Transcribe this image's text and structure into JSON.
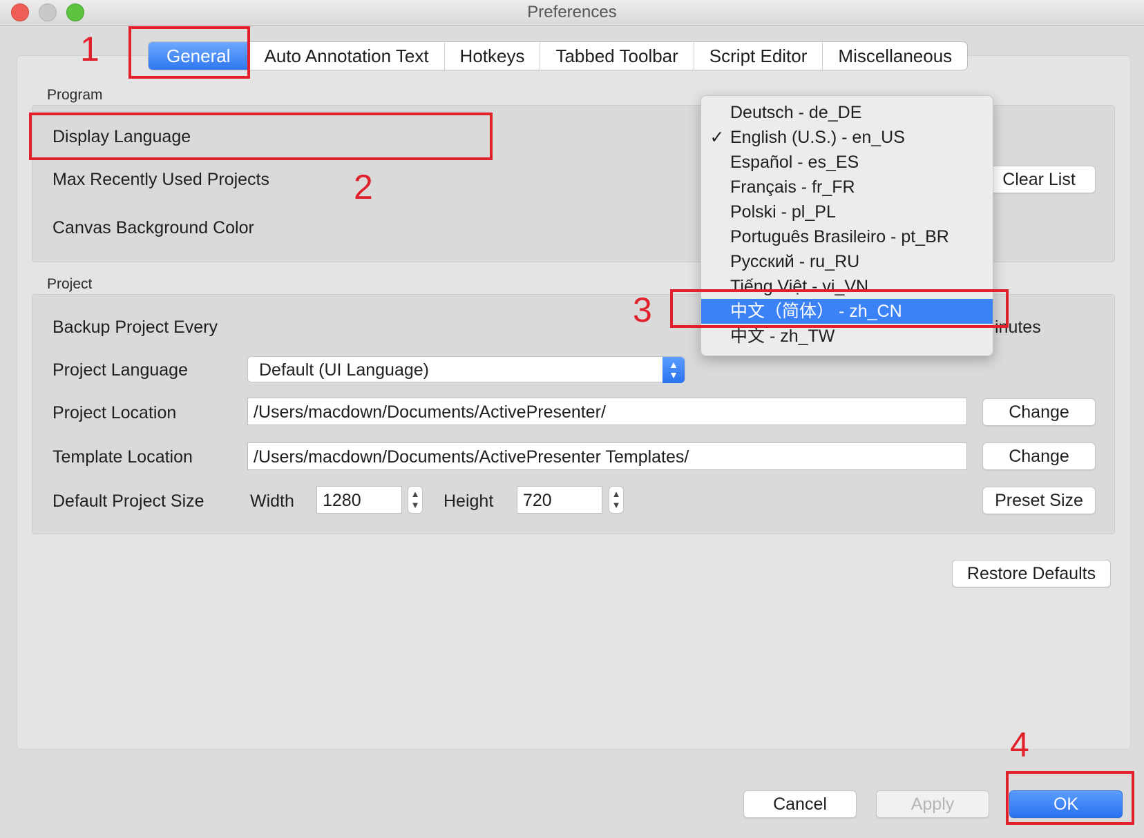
{
  "window": {
    "title": "Preferences"
  },
  "tabs": [
    {
      "label": "General",
      "active": true
    },
    {
      "label": "Auto Annotation Text",
      "active": false
    },
    {
      "label": "Hotkeys",
      "active": false
    },
    {
      "label": "Tabbed Toolbar",
      "active": false
    },
    {
      "label": "Script Editor",
      "active": false
    },
    {
      "label": "Miscellaneous",
      "active": false
    }
  ],
  "program": {
    "section_label": "Program",
    "display_language_label": "Display Language",
    "max_recent_label": "Max Recently Used Projects",
    "clear_list_label": "Clear List",
    "canvas_bg_label": "Canvas Background Color"
  },
  "project": {
    "section_label": "Project",
    "backup_label": "Backup Project Every",
    "backup_units_partial": "inutes",
    "project_language_label": "Project Language",
    "project_language_value": "Default (UI Language)",
    "project_location_label": "Project Location",
    "project_location_value": "/Users/macdown/Documents/ActivePresenter/",
    "template_location_label": "Template Location",
    "template_location_value": "/Users/macdown/Documents/ActivePresenter Templates/",
    "change_label": "Change",
    "default_size_label": "Default Project Size",
    "width_label": "Width",
    "width_value": "1280",
    "height_label": "Height",
    "height_value": "720",
    "preset_size_label": "Preset Size"
  },
  "restore_defaults_label": "Restore Defaults",
  "footer": {
    "cancel_label": "Cancel",
    "apply_label": "Apply",
    "ok_label": "OK"
  },
  "language_menu": {
    "items": [
      {
        "label": "Deutsch - de_DE",
        "checked": false,
        "highlighted": false
      },
      {
        "label": "English (U.S.) - en_US",
        "checked": true,
        "highlighted": false
      },
      {
        "label": "Español - es_ES",
        "checked": false,
        "highlighted": false
      },
      {
        "label": "Français - fr_FR",
        "checked": false,
        "highlighted": false
      },
      {
        "label": "Polski - pl_PL",
        "checked": false,
        "highlighted": false
      },
      {
        "label": "Português Brasileiro - pt_BR",
        "checked": false,
        "highlighted": false
      },
      {
        "label": "Русский - ru_RU",
        "checked": false,
        "highlighted": false
      },
      {
        "label": "Tiếng Việt - vi_VN",
        "checked": false,
        "highlighted": false
      },
      {
        "label": "中文（简体） - zh_CN",
        "checked": false,
        "highlighted": true
      },
      {
        "label": "中文 - zh_TW",
        "checked": false,
        "highlighted": false
      }
    ],
    "check_glyph": "✓"
  },
  "annotations": {
    "step1": "1",
    "step2": "2",
    "step3": "3",
    "step4": "4",
    "color": "#e0202a"
  },
  "colors": {
    "accent": "#3b82f6",
    "annotation_red": "#e0202a"
  },
  "icons": {
    "select_arrows": "up-down-chevron-icon",
    "stepper": "stepper-arrows-icon"
  }
}
